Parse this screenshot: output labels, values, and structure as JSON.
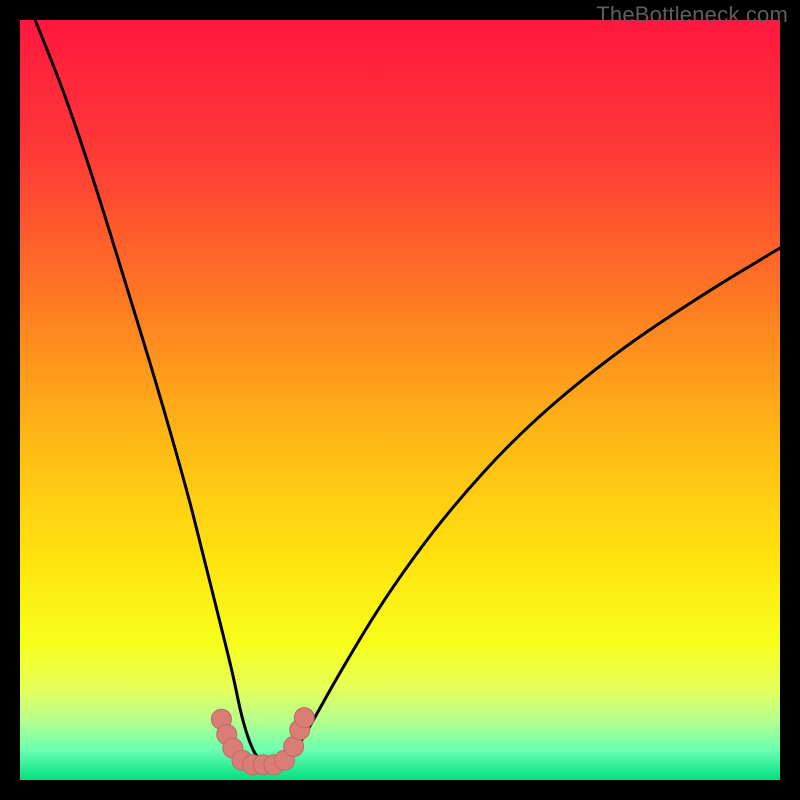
{
  "watermark": "TheBottleneck.com",
  "colors": {
    "gradient_stops": [
      {
        "offset": 0.0,
        "color": "#ff183f"
      },
      {
        "offset": 0.18,
        "color": "#ff3a36"
      },
      {
        "offset": 0.38,
        "color": "#ff7d22"
      },
      {
        "offset": 0.55,
        "color": "#ffb815"
      },
      {
        "offset": 0.72,
        "color": "#ffe60f"
      },
      {
        "offset": 0.82,
        "color": "#f7ff1a"
      },
      {
        "offset": 0.88,
        "color": "#e4ff5a"
      },
      {
        "offset": 0.92,
        "color": "#b8ff8c"
      },
      {
        "offset": 0.96,
        "color": "#6cffb0"
      },
      {
        "offset": 1.0,
        "color": "#00e082"
      }
    ],
    "curve": "#000000",
    "marker_fill": "#db7d77",
    "marker_stroke": "#c26662",
    "frame": "#000000"
  },
  "chart_data": {
    "type": "line",
    "title": "",
    "xlabel": "",
    "ylabel": "",
    "xlim": [
      0,
      100
    ],
    "ylim": [
      0,
      100
    ],
    "grid": false,
    "legend_position": "none",
    "annotations": [
      "TheBottleneck.com"
    ],
    "series": [
      {
        "name": "bottleneck-curve",
        "x": [
          2,
          6,
          10,
          14,
          18,
          22,
          24,
          26,
          28,
          29,
          30,
          31,
          32,
          33,
          34,
          36,
          38,
          42,
          48,
          56,
          66,
          78,
          90,
          100
        ],
        "values": [
          100,
          90,
          78,
          65,
          52,
          38,
          30,
          22,
          14,
          9,
          5.5,
          3.2,
          2.2,
          2.0,
          2.2,
          3.5,
          6.8,
          14,
          24,
          35,
          46,
          56,
          64,
          70
        ]
      }
    ],
    "markers": [
      {
        "x": 26.5,
        "y": 8.0
      },
      {
        "x": 27.2,
        "y": 6.0
      },
      {
        "x": 28.0,
        "y": 4.2
      },
      {
        "x": 29.2,
        "y": 2.6
      },
      {
        "x": 30.6,
        "y": 2.0
      },
      {
        "x": 32.0,
        "y": 2.0
      },
      {
        "x": 33.4,
        "y": 2.0
      },
      {
        "x": 34.8,
        "y": 2.6
      },
      {
        "x": 36.0,
        "y": 4.4
      },
      {
        "x": 36.8,
        "y": 6.6
      },
      {
        "x": 37.4,
        "y": 8.2
      }
    ]
  }
}
